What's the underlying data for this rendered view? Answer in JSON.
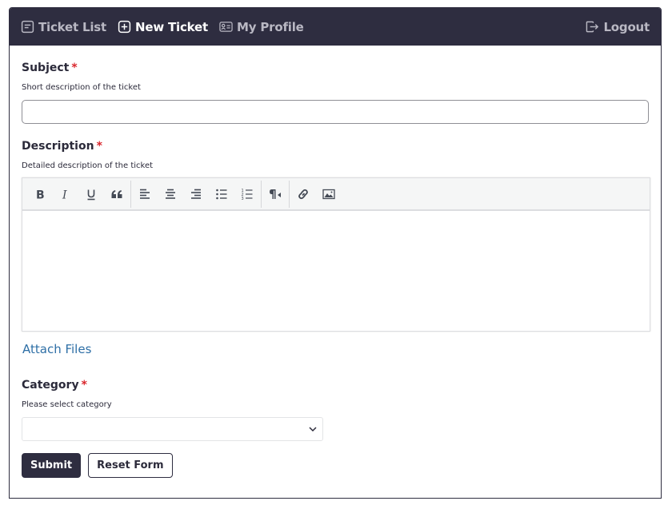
{
  "nav": {
    "items": [
      {
        "label": "Ticket List",
        "icon": "list-icon",
        "active": false
      },
      {
        "label": "New Ticket",
        "icon": "plus-square-icon",
        "active": true
      },
      {
        "label": "My Profile",
        "icon": "id-card-icon",
        "active": false
      }
    ],
    "logout": {
      "label": "Logout",
      "icon": "logout-icon"
    }
  },
  "form": {
    "subject": {
      "label": "Subject",
      "required_mark": "*",
      "help": "Short description of the ticket",
      "value": "",
      "placeholder": ""
    },
    "description": {
      "label": "Description",
      "required_mark": "*",
      "help": "Detailed description of the ticket",
      "value": "",
      "toolbar": [
        "bold",
        "italic",
        "underline",
        "blockquote",
        "align-left",
        "align-center",
        "align-right",
        "bullet-list",
        "numbered-list",
        "text-direction",
        "link",
        "image"
      ]
    },
    "attach_files_label": "Attach Files",
    "category": {
      "label": "Category",
      "required_mark": "*",
      "help": "Please select category",
      "selected": ""
    },
    "submit_label": "Submit",
    "reset_label": "Reset Form"
  },
  "colors": {
    "nav_bg": "#2e2d40",
    "required": "#d9262c",
    "link": "#2e6fa6"
  }
}
